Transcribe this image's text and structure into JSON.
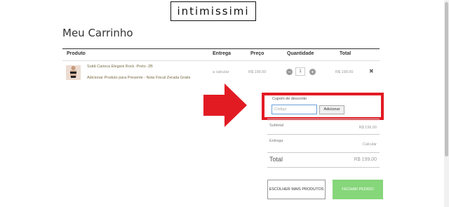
{
  "header": {
    "logo_text": "intimissimi"
  },
  "page": {
    "title": "Meu Carrinho"
  },
  "table": {
    "headers": {
      "product": "Produto",
      "delivery": "Entrega",
      "price": "Preço",
      "quantity": "Quantidade",
      "total": "Total"
    },
    "items": [
      {
        "name": "Sutiã Carioca Elegant Rock -Preto -2B",
        "addon": "Adicionar Produto para Presente - Nota Fiscal Zerada Gratis",
        "delivery": "a calcular",
        "price": "R$ 199,00",
        "quantity": "1",
        "total": "R$ 199,00"
      }
    ]
  },
  "coupon": {
    "label": "Cupom de desconto",
    "placeholder": "Código",
    "button": "Adicionar"
  },
  "summary": {
    "subtotal_label": "Subtotal",
    "subtotal_value": "R$ 199,00",
    "delivery_label": "Entrega",
    "delivery_value": "Calcular",
    "total_label": "Total",
    "total_value": "R$ 199,00"
  },
  "actions": {
    "continue_shopping": "ESCOLHER MAIS PRODUTOS",
    "checkout": "FECHAR PEDIDO"
  },
  "colors": {
    "highlight": "#e21b23",
    "checkout_button": "#86d67a",
    "link": "#7a6c45"
  }
}
